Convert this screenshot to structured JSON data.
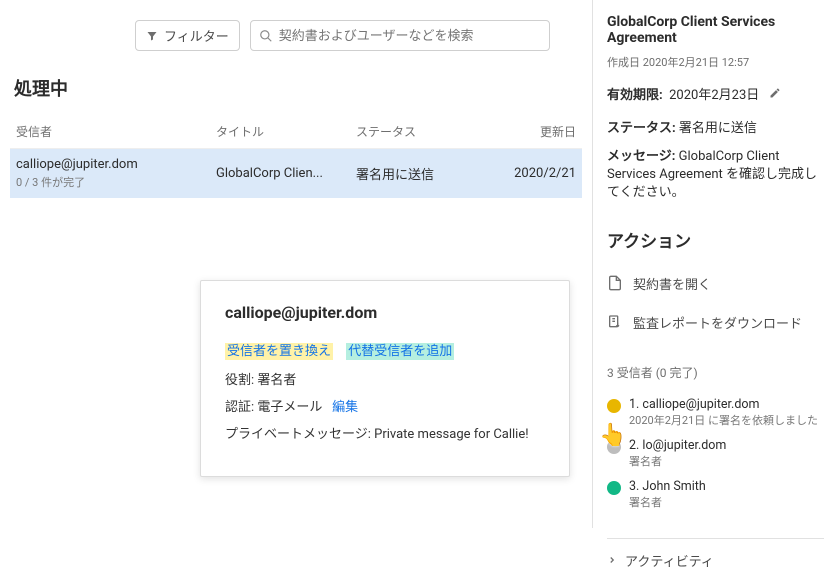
{
  "controls": {
    "filter_label": "フィルター",
    "search_placeholder": "契約書およびユーザーなどを検索"
  },
  "section_title": "処理中",
  "columns": {
    "recipient": "受信者",
    "title": "タイトル",
    "status": "ステータス",
    "updated": "更新日"
  },
  "row": {
    "recipient": "calliope@jupiter.dom",
    "progress": "0 / 3 件が完了",
    "title": "GlobalCorp Clien...",
    "status": "署名用に送信",
    "updated": "2020/2/21"
  },
  "popover": {
    "email": "calliope@jupiter.dom",
    "replace_label": "受信者を置き換え",
    "add_alt_label": "代替受信者を追加",
    "role_label": "役割",
    "role_value": "署名者",
    "auth_label": "認証",
    "auth_value": "電子メール",
    "auth_edit": "編集",
    "pm_label": "プライベートメッセージ",
    "pm_value": "Private message for Callie!"
  },
  "side": {
    "title": "GlobalCorp Client Services Agreement",
    "created": "作成日 2020年2月21日 12:57",
    "expiry_label": "有効期限:",
    "expiry_value": "2020年2月23日",
    "status_label": "ステータス:",
    "status_value": "署名用に送信",
    "message_label": "メッセージ:",
    "message_value": "GlobalCorp Client Services Agreement を確認し完成してください。",
    "actions_header": "アクション",
    "open_label": "契約書を開く",
    "audit_label": "監査レポートをダウンロード",
    "recipients_header": "3 受信者 (0 完了)",
    "recipients": [
      {
        "name": "1. calliope@jupiter.dom",
        "sub": "2020年2月21日 に署名を依頼しました"
      },
      {
        "name": "2. lo@jupiter.dom",
        "sub": "署名者"
      },
      {
        "name": "3. John Smith",
        "sub": "署名者"
      }
    ],
    "activity_label": "アクティビティ"
  }
}
